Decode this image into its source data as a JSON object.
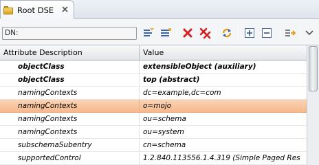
{
  "tab": {
    "title": "Root DSE",
    "icon": "root-dse-icon",
    "close_icon": "close-icon"
  },
  "toolbar": {
    "dn_label": "DN:",
    "buttons": [
      {
        "name": "new-value-button",
        "icon": "new-value-icon"
      },
      {
        "name": "new-attribute-button",
        "icon": "new-attribute-icon"
      },
      {
        "name": "delete-button",
        "icon": "delete-icon"
      },
      {
        "name": "delete-all-button",
        "icon": "delete-all-icon"
      },
      {
        "name": "refresh-button",
        "icon": "refresh-icon"
      },
      {
        "name": "expand-all-button",
        "icon": "expand-all-icon"
      },
      {
        "name": "collapse-all-button",
        "icon": "collapse-all-icon"
      },
      {
        "name": "link-with-editor-button",
        "icon": "link-icon"
      },
      {
        "name": "view-menu-button",
        "icon": "chevron-down-icon"
      }
    ]
  },
  "table": {
    "columns": {
      "attribute": "Attribute Description",
      "value": "Value"
    },
    "rows": [
      {
        "attribute": "objectClass",
        "value": "extensibleObject (auxiliary)",
        "bold": true,
        "selected": false
      },
      {
        "attribute": "objectClass",
        "value": "top (abstract)",
        "bold": true,
        "selected": false
      },
      {
        "attribute": "namingContexts",
        "value": "dc=example,dc=com",
        "bold": false,
        "selected": false
      },
      {
        "attribute": "namingContexts",
        "value": "o=mojo",
        "bold": false,
        "selected": true
      },
      {
        "attribute": "namingContexts",
        "value": "ou=schema",
        "bold": false,
        "selected": false
      },
      {
        "attribute": "namingContexts",
        "value": "ou=system",
        "bold": false,
        "selected": false
      },
      {
        "attribute": "subschemaSubentry",
        "value": "cn=schema",
        "bold": false,
        "selected": false
      },
      {
        "attribute": "supportedControl",
        "value": "1.2.840.113556.1.4.319 (Simple Paged Res",
        "bold": false,
        "selected": false
      }
    ]
  },
  "colors": {
    "selection": "#f7c39b",
    "delete_red": "#d42020"
  }
}
